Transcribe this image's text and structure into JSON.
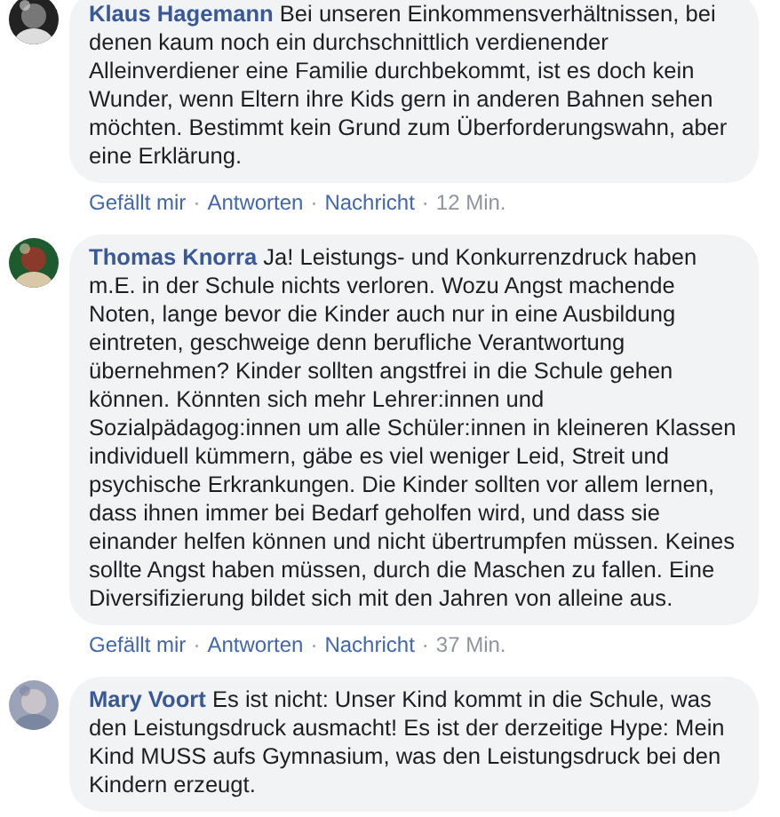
{
  "separator": "·",
  "comments": [
    {
      "author": "Klaus Hagemann",
      "text": "Bei unseren Einkommensverhältnissen, bei denen kaum noch ein durchschnittlich verdienender Alleinverdiener eine Familie durchbekommt, ist es doch kein Wunder, wenn Eltern ihre Kids gern in anderen Bahnen sehen möchten. Bestimmt kein Grund zum Überforderungswahn, aber eine Erklärung.",
      "actions": [
        "Gefällt mir",
        "Antworten",
        "Nachricht"
      ],
      "time": "12 Min."
    },
    {
      "author": "Thomas Knorra",
      "text": "Ja! Leistungs- und Konkurrenzdruck haben m.E. in der Schule nichts verloren. Wozu Angst machende Noten, lange bevor die Kinder auch nur in eine Ausbildung eintreten, geschweige denn berufliche Verantwortung übernehmen? Kinder sollten angstfrei in die Schule gehen können. Könnten sich mehr Lehrer:innen und Sozialpädagog:innen um alle Schüler:innen in kleineren Klassen individuell kümmern, gäbe es viel weniger Leid, Streit und psychische Erkrankungen. Die Kinder sollten vor allem lernen, dass ihnen immer bei Bedarf geholfen wird, und dass sie einander helfen können und nicht übertrumpfen müssen. Keines sollte Angst haben müssen, durch die Maschen zu fallen. Eine Diversifizierung bildet sich mit den Jahren von alleine aus.",
      "actions": [
        "Gefällt mir",
        "Antworten",
        "Nachricht"
      ],
      "time": "37 Min."
    },
    {
      "author": "Mary Voort",
      "text": "Es ist nicht: Unser Kind kommt in die Schule, was den Leistungsdruck ausmacht! Es ist der derzeitige Hype: Mein Kind MUSS aufs Gymnasium, was den Leistungsdruck bei den Kindern erzeugt."
    }
  ]
}
